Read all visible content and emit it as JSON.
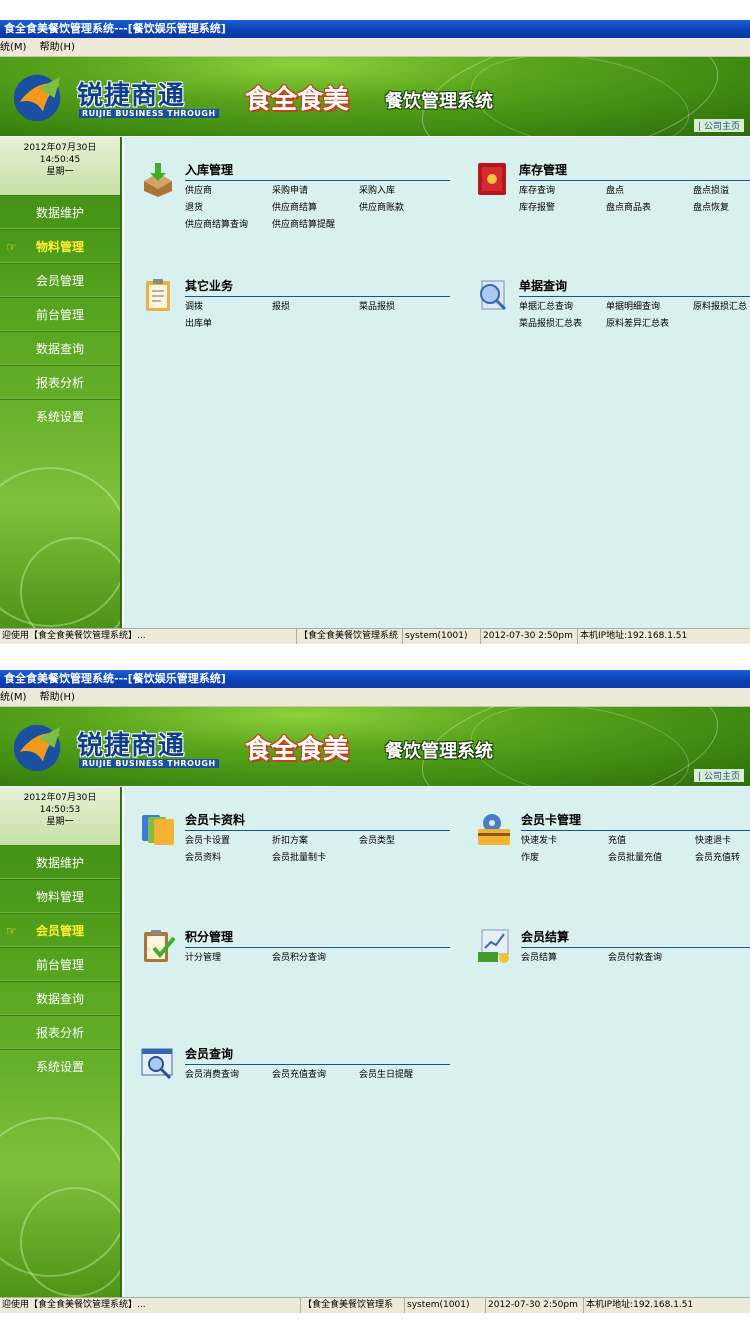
{
  "windows": [
    {
      "title": "食全食美餐饮管理系统---[餐饮娱乐管理系统]",
      "menu": [
        "统(M)",
        "帮助(H)"
      ],
      "logo_text": "锐捷商通",
      "logo_sub": "RUIJIE BUSINESS THROUGH",
      "brand": "食全食美",
      "product": "餐饮管理系统",
      "company_link": "| 公司主页",
      "clock": {
        "date": "2012年07月30日",
        "time": "14:50:45",
        "weekday": "星期一"
      },
      "nav": [
        "数据维护",
        "物料管理",
        "会员管理",
        "前台管理",
        "数据查询",
        "报表分析",
        "系统设置"
      ],
      "active_nav": 1,
      "groups": [
        {
          "title": "入库管理",
          "icon": "inbox-tray-icon",
          "links": [
            "供应商",
            "采购申请",
            "采购入库",
            "退货",
            "供应商结算",
            "供应商账款",
            "供应商结算查询",
            "供应商结算提醒"
          ]
        },
        {
          "title": "库存管理",
          "icon": "safe-icon",
          "links": [
            "库存查询",
            "盘点",
            "盘点损溢",
            "库存报警",
            "盘点商品表",
            "盘点恢复"
          ]
        },
        {
          "title": "其它业务",
          "icon": "clipboard-icon",
          "links": [
            "调拨",
            "报损",
            "菜品报损",
            "出库单"
          ]
        },
        {
          "title": "单据查询",
          "icon": "magnifier-document-icon",
          "links": [
            "单据汇总查询",
            "单据明细查询",
            "原料报损汇总",
            "菜品报损汇总表",
            "原料差异汇总表"
          ]
        }
      ],
      "status": [
        "迎使用【食全食美餐饮管理系统】...",
        "【食全食美餐饮管理系统",
        "system(1001)",
        "2012-07-30 2:50pm",
        "本机IP地址:192.168.1.51"
      ]
    },
    {
      "title": "食全食美餐饮管理系统---[餐饮娱乐管理系统]",
      "menu": [
        "统(M)",
        "帮助(H)"
      ],
      "logo_text": "锐捷商通",
      "logo_sub": "RUIJIE BUSINESS THROUGH",
      "brand": "食全食美",
      "product": "餐饮管理系统",
      "company_link": "| 公司主页",
      "clock": {
        "date": "2012年07月30日",
        "time": "14:50:53",
        "weekday": "星期一"
      },
      "nav": [
        "数据维护",
        "物料管理",
        "会员管理",
        "前台管理",
        "数据查询",
        "报表分析",
        "系统设置"
      ],
      "active_nav": 2,
      "groups": [
        {
          "title": "会员卡资料",
          "icon": "cards-icon",
          "links": [
            "会员卡设置",
            "折扣方案",
            "会员类型",
            "会员资料",
            "会员批量制卡"
          ]
        },
        {
          "title": "会员卡管理",
          "icon": "card-gear-icon",
          "links": [
            "快速发卡",
            "充值",
            "快速退卡",
            "作废",
            "会员批量充值",
            "会员充值转"
          ]
        },
        {
          "title": "积分管理",
          "icon": "clipboard-check-icon",
          "links": [
            "计分管理",
            "会员积分查询"
          ]
        },
        {
          "title": "会员结算",
          "icon": "money-chart-icon",
          "links": [
            "会员结算",
            "会员付款查询"
          ]
        },
        {
          "title": "会员查询",
          "icon": "search-window-icon",
          "links": [
            "会员消费查询",
            "会员充值查询",
            "会员生日提醒"
          ]
        }
      ],
      "status": [
        "迎使用【食全食美餐饮管理系统】...",
        "【食全食美餐饮管理系",
        "system(1001)",
        "2012-07-30 2:50pm",
        "本机IP地址:192.168.1.51"
      ]
    }
  ]
}
